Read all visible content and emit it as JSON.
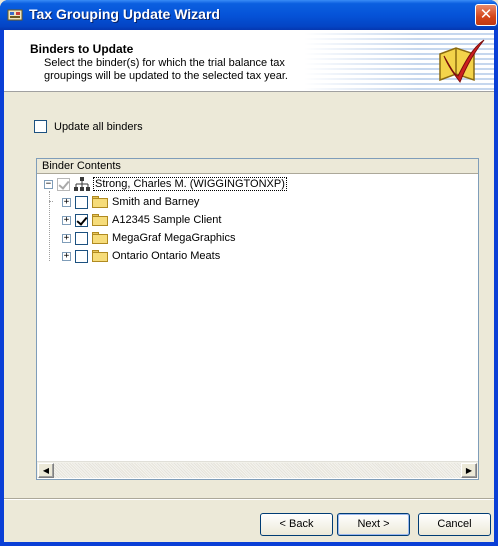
{
  "window": {
    "title": "Tax Grouping Update Wizard",
    "close_glyph": "✕"
  },
  "header": {
    "title": "Binders to Update",
    "description": "Select the binder(s) for which the trial balance tax groupings will be updated to the selected tax year.",
    "logo_icon": "red-checkmark-book-icon"
  },
  "update_all": {
    "label": "Update all binders",
    "checked": false
  },
  "binder_contents": {
    "header": "Binder Contents",
    "root": {
      "label": "Strong, Charles M. (WIGGINGTONXP)",
      "expander": "−",
      "checked": true,
      "icon": "network-icon"
    },
    "items": [
      {
        "label": "Smith and Barney",
        "expander": "+",
        "checked": false,
        "icon": "folder-icon"
      },
      {
        "label": "A12345 Sample Client",
        "expander": "+",
        "checked": true,
        "icon": "folder-icon"
      },
      {
        "label": "MegaGraf MegaGraphics",
        "expander": "+",
        "checked": false,
        "icon": "folder-icon"
      },
      {
        "label": "Ontario Ontario Meats",
        "expander": "+",
        "checked": false,
        "icon": "folder-icon"
      }
    ],
    "scroll_left": "◀",
    "scroll_right": "▶"
  },
  "buttons": {
    "back": "< Back",
    "next": "Next >",
    "cancel": "Cancel"
  },
  "colors": {
    "title_bar": "#0553d8",
    "dialog": "#ece9d8",
    "accent_red": "#cc1f1f"
  }
}
